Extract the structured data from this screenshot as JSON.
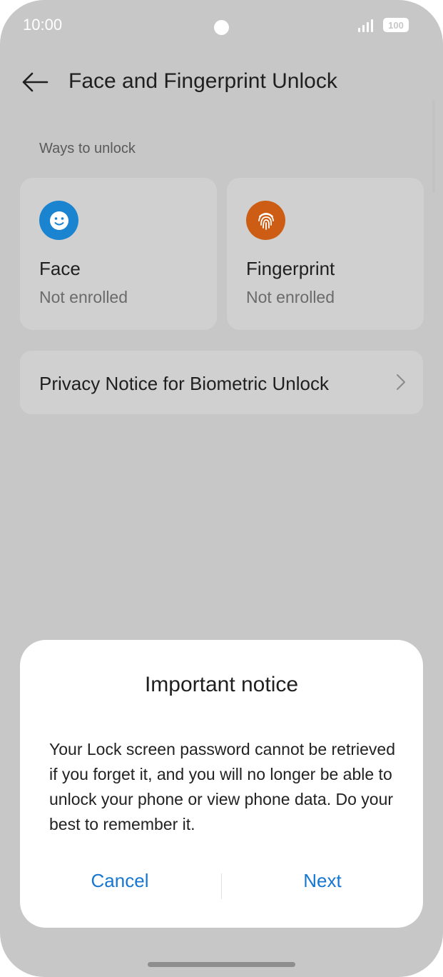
{
  "status_bar": {
    "time": "10:00",
    "battery": "100"
  },
  "header": {
    "title": "Face and Fingerprint Unlock",
    "back_icon": "arrow-left-icon"
  },
  "section": {
    "label": "Ways to unlock"
  },
  "cards": [
    {
      "title": "Face",
      "status": "Not enrolled",
      "icon": "face-icon",
      "color": "#1a84d1"
    },
    {
      "title": "Fingerprint",
      "status": "Not enrolled",
      "icon": "fingerprint-icon",
      "color": "#cd5d14"
    }
  ],
  "privacy": {
    "label": "Privacy Notice for Biometric Unlock"
  },
  "dialog": {
    "title": "Important notice",
    "body": "Your Lock screen password cannot be retrieved if you forget it, and you will no longer be able to unlock your phone or view phone data. Do your best to remember it.",
    "cancel_label": "Cancel",
    "next_label": "Next",
    "accent": "#1677d2"
  }
}
